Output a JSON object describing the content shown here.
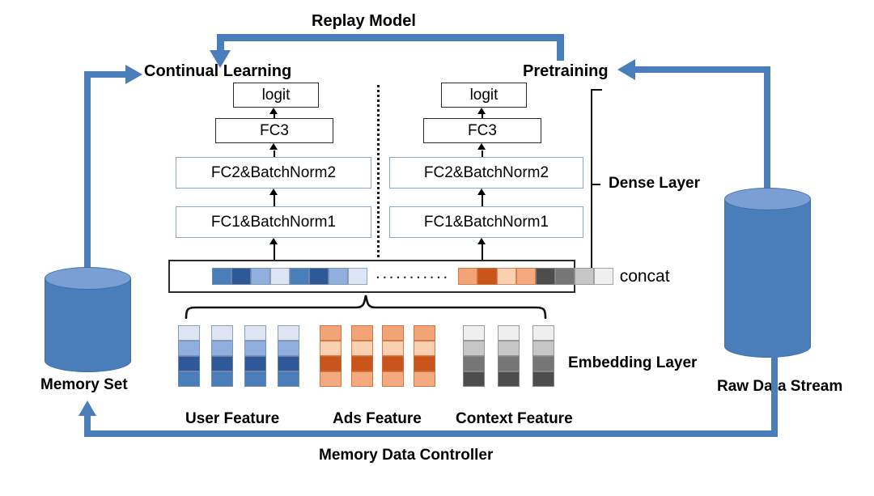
{
  "diagram": {
    "title_flows": {
      "replay_model": "Replay Model",
      "memory_data_controller": "Memory Data Controller"
    },
    "stages": {
      "continual_learning": "Continual Learning",
      "pretraining": "Pretraining"
    },
    "storage": {
      "memory_set": "Memory Set",
      "raw_data_stream": "Raw Data Stream"
    },
    "group_labels": {
      "dense_layer": "Dense Layer",
      "embedding_layer": "Embedding Layer"
    },
    "dense_stack": {
      "logit": "logit",
      "fc3": "FC3",
      "fc2": "FC2&BatchNorm2",
      "fc1": "FC1&BatchNorm1"
    },
    "concat": {
      "label": "concat",
      "ellipsis": "...........",
      "blue_cells": [
        "#4a7ebb",
        "#2e5897",
        "#90aede",
        "#dde5f4",
        "#4a7ebb",
        "#2e5897",
        "#90aede",
        "#dde5f4"
      ],
      "orange_cells": [
        "#f2a477",
        "#c9541c",
        "#fbcfb2",
        "#f4a97f"
      ],
      "gray_cells": [
        "#4d4d4d",
        "#767676",
        "#c6c6c6",
        "#efefef"
      ]
    },
    "features": {
      "user": {
        "label": "User Feature",
        "count": 4,
        "cells": [
          "#dde5f4",
          "#90aede",
          "#2e5897",
          "#4a7ebb"
        ]
      },
      "ads": {
        "label": "Ads Feature",
        "count": 4,
        "cells": [
          "#f2a477",
          "#fbcfb2",
          "#c9541c",
          "#f4a97f"
        ]
      },
      "context": {
        "label": "Context Feature",
        "count": 3,
        "cells": [
          "#efefef",
          "#c6c6c6",
          "#767676",
          "#4d4d4d"
        ]
      }
    },
    "colors": {
      "accent_blue": "#4a7ebb",
      "cylinder_top": "#7a9fd4",
      "box_dark_border": "#2b2b2b",
      "box_soft_border": "#8fa5c4",
      "black": "#000000",
      "background": "#ffffff"
    }
  }
}
